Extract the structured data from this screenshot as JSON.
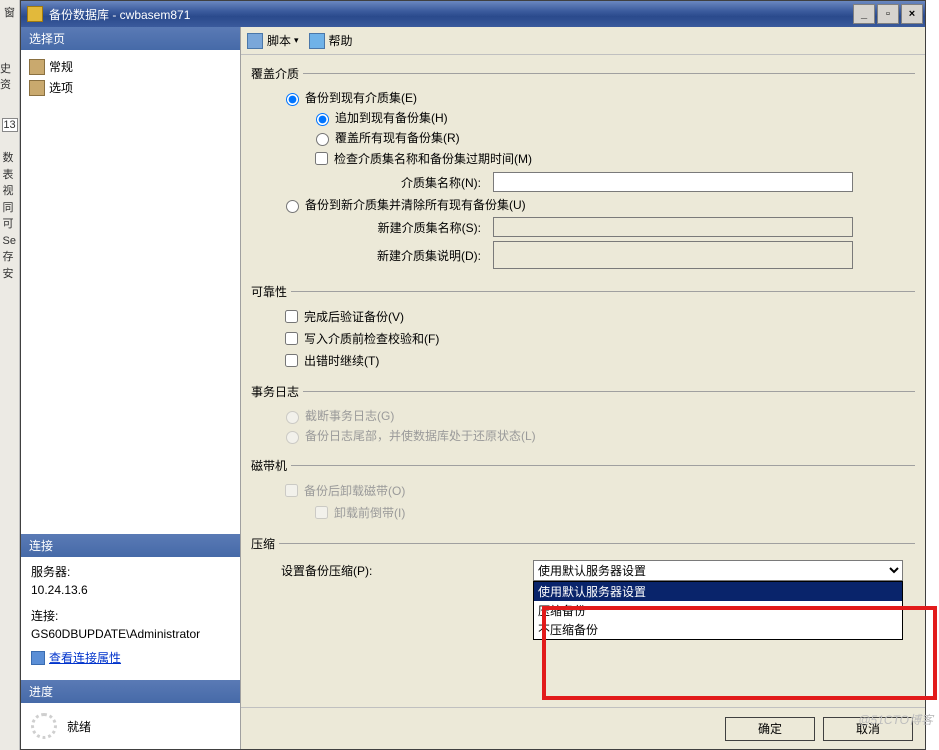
{
  "window": {
    "title": "备份数据库 - cwbasem871",
    "min_label": "_",
    "restore_label": "▫",
    "close_label": "×"
  },
  "left_strip": {
    "c1": "窗",
    "c2": "史资",
    "c3": "13",
    "c4": "数 表 视 同 可 Se 存 安"
  },
  "sidebar": {
    "select_page": "选择页",
    "items": [
      {
        "label": "常规"
      },
      {
        "label": "选项"
      }
    ],
    "connection_hdr": "连接",
    "server_lbl": "服务器:",
    "server_val": "10.24.13.6",
    "conn_lbl": "连接:",
    "conn_val": "GS60DBUPDATE\\Administrator",
    "view_props": "查看连接属性",
    "progress_hdr": "进度",
    "progress_status": "就绪"
  },
  "toolbar": {
    "script": "脚本",
    "arrow": "▾",
    "help": "帮助"
  },
  "groups": {
    "overwrite": "覆盖介质",
    "reliability": "可靠性",
    "txlog": "事务日志",
    "tape": "磁带机",
    "compress": "压缩"
  },
  "overwrite": {
    "r1": "备份到现有介质集(E)",
    "r1a": "追加到现有备份集(H)",
    "r1b": "覆盖所有现有备份集(R)",
    "chk": "检查介质集名称和备份集过期时间(M)",
    "media_name": "介质集名称(N):",
    "r2": "备份到新介质集并清除所有现有备份集(U)",
    "new_media_name": "新建介质集名称(S):",
    "new_media_desc": "新建介质集说明(D):"
  },
  "reliability": {
    "c1": "完成后验证备份(V)",
    "c2": "写入介质前检查校验和(F)",
    "c3": "出错时继续(T)"
  },
  "txlog": {
    "r1": "截断事务日志(G)",
    "r2": "备份日志尾部，并使数据库处于还原状态(L)"
  },
  "tape": {
    "c1": "备份后卸载磁带(O)",
    "c2": "卸载前倒带(I)"
  },
  "compress": {
    "label": "设置备份压缩(P):",
    "selected": "使用默认服务器设置",
    "options": [
      "使用默认服务器设置",
      "压缩备份",
      "不压缩备份"
    ]
  },
  "footer": {
    "ok": "确定",
    "cancel": "取消"
  },
  "watermark": "@51CTO博客"
}
